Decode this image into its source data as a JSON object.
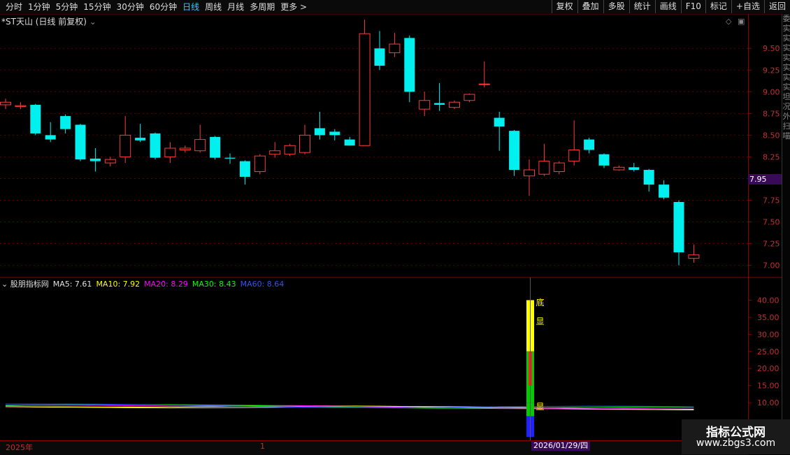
{
  "toolbar": {
    "periods": [
      "分时",
      "1分钟",
      "5分钟",
      "15分钟",
      "30分钟",
      "60分钟",
      "日线",
      "周线",
      "月线",
      "多周期",
      "更多 >"
    ],
    "active_period": "日线",
    "actions": [
      "复权",
      "叠加",
      "多股",
      "统计",
      "画线",
      "F10",
      "标记",
      "+自选",
      "返回"
    ]
  },
  "main_title": "*ST天山 (日线 前复权)",
  "price_axis_ticks": [
    "9.50",
    "9.25",
    "9.00",
    "8.75",
    "8.50",
    "8.25",
    "7.95",
    "7.75",
    "7.50",
    "7.25",
    "7.00"
  ],
  "current_price_label": "7.95",
  "indicator": {
    "name": "股朋指标网",
    "ma_labels": [
      {
        "text": "MA5: 7.61",
        "color": "#e0e0e0"
      },
      {
        "text": "MA10: 7.92",
        "color": "#ffff00"
      },
      {
        "text": "MA20: 8.29",
        "color": "#ff00ff"
      },
      {
        "text": "MA30: 8.43",
        "color": "#00ff00"
      },
      {
        "text": "MA60: 8.64",
        "color": "#3050ff"
      }
    ],
    "axis_ticks": [
      "40.00",
      "35.00",
      "30.00",
      "25.00",
      "20.00",
      "15.00",
      "10.00"
    ],
    "signal_texts": [
      "底",
      "显",
      "显"
    ]
  },
  "date_labels": {
    "left": "2025年",
    "mid": "1",
    "cursor": "2026/01/29/四"
  },
  "right_strip_chars": [
    "委",
    "实",
    "实",
    "实",
    "实",
    "实",
    "实",
    "实",
    "坦",
    "况",
    "外",
    "扫",
    "喵"
  ],
  "watermark": {
    "line1": "指标公式网",
    "line2": "www.zbgs3.com"
  },
  "chart_data": {
    "type": "candlestick",
    "y_axis": {
      "min": 6.9,
      "max": 9.8,
      "ticks": [
        7.0,
        7.25,
        7.5,
        7.75,
        8.0,
        8.25,
        8.5,
        8.75,
        9.0,
        9.25,
        9.5
      ]
    },
    "candles": [
      {
        "o": 8.85,
        "c": 8.88,
        "h": 8.92,
        "l": 8.8
      },
      {
        "o": 8.83,
        "c": 8.84,
        "h": 8.88,
        "l": 8.8
      },
      {
        "o": 8.85,
        "c": 8.52,
        "h": 8.86,
        "l": 8.5
      },
      {
        "o": 8.5,
        "c": 8.45,
        "h": 8.65,
        "l": 8.42
      },
      {
        "o": 8.72,
        "c": 8.57,
        "h": 8.74,
        "l": 8.52
      },
      {
        "o": 8.62,
        "c": 8.22,
        "h": 8.63,
        "l": 8.2
      },
      {
        "o": 8.23,
        "c": 8.2,
        "h": 8.35,
        "l": 8.08
      },
      {
        "o": 8.18,
        "c": 8.22,
        "h": 8.25,
        "l": 8.14
      },
      {
        "o": 8.25,
        "c": 8.5,
        "h": 8.72,
        "l": 8.18
      },
      {
        "o": 8.47,
        "c": 8.44,
        "h": 8.63,
        "l": 8.42
      },
      {
        "o": 8.52,
        "c": 8.24,
        "h": 8.53,
        "l": 8.22
      },
      {
        "o": 8.25,
        "c": 8.35,
        "h": 8.42,
        "l": 8.18
      },
      {
        "o": 8.33,
        "c": 8.35,
        "h": 8.38,
        "l": 8.3
      },
      {
        "o": 8.32,
        "c": 8.45,
        "h": 8.62,
        "l": 8.3
      },
      {
        "o": 8.48,
        "c": 8.24,
        "h": 8.49,
        "l": 8.22
      },
      {
        "o": 8.24,
        "c": 8.23,
        "h": 8.29,
        "l": 8.17
      },
      {
        "o": 8.2,
        "c": 8.02,
        "h": 8.21,
        "l": 7.93
      },
      {
        "o": 8.08,
        "c": 8.26,
        "h": 8.28,
        "l": 8.05
      },
      {
        "o": 8.28,
        "c": 8.32,
        "h": 8.42,
        "l": 8.24
      },
      {
        "o": 8.28,
        "c": 8.38,
        "h": 8.4,
        "l": 8.26
      },
      {
        "o": 8.3,
        "c": 8.5,
        "h": 8.62,
        "l": 8.28
      },
      {
        "o": 8.58,
        "c": 8.5,
        "h": 8.77,
        "l": 8.45
      },
      {
        "o": 8.54,
        "c": 8.5,
        "h": 8.57,
        "l": 8.44
      },
      {
        "o": 8.45,
        "c": 8.38,
        "h": 8.48,
        "l": 8.38
      },
      {
        "o": 8.38,
        "c": 9.67,
        "h": 9.83,
        "l": 8.38
      },
      {
        "o": 9.5,
        "c": 9.3,
        "h": 9.7,
        "l": 9.25
      },
      {
        "o": 9.45,
        "c": 9.55,
        "h": 9.68,
        "l": 9.4
      },
      {
        "o": 9.62,
        "c": 9.0,
        "h": 9.65,
        "l": 8.88
      },
      {
        "o": 8.8,
        "c": 8.9,
        "h": 9.0,
        "l": 8.72
      },
      {
        "o": 8.87,
        "c": 8.85,
        "h": 9.1,
        "l": 8.78
      },
      {
        "o": 8.82,
        "c": 8.88,
        "h": 8.9,
        "l": 8.8
      },
      {
        "o": 8.9,
        "c": 8.97,
        "h": 8.98,
        "l": 8.88
      },
      {
        "o": 9.09,
        "c": 9.09,
        "h": 9.35,
        "l": 9.05
      },
      {
        "o": 8.7,
        "c": 8.6,
        "h": 8.77,
        "l": 8.32
      },
      {
        "o": 8.55,
        "c": 8.1,
        "h": 8.56,
        "l": 8.03
      },
      {
        "o": 8.03,
        "c": 8.1,
        "h": 8.22,
        "l": 7.8
      },
      {
        "o": 8.05,
        "c": 8.2,
        "h": 8.4,
        "l": 8.03
      },
      {
        "o": 8.08,
        "c": 8.18,
        "h": 8.2,
        "l": 8.05
      },
      {
        "o": 8.2,
        "c": 8.33,
        "h": 8.67,
        "l": 8.15
      },
      {
        "o": 8.45,
        "c": 8.33,
        "h": 8.47,
        "l": 8.29
      },
      {
        "o": 8.28,
        "c": 8.15,
        "h": 8.29,
        "l": 8.12
      },
      {
        "o": 8.1,
        "c": 8.13,
        "h": 8.15,
        "l": 8.09
      },
      {
        "o": 8.13,
        "c": 8.1,
        "h": 8.18,
        "l": 8.08
      },
      {
        "o": 8.1,
        "c": 7.93,
        "h": 8.11,
        "l": 7.85
      },
      {
        "o": 7.93,
        "c": 7.78,
        "h": 7.98,
        "l": 7.76
      },
      {
        "o": 7.73,
        "c": 7.15,
        "h": 7.75,
        "l": 7.0
      },
      {
        "o": 7.08,
        "c": 7.12,
        "h": 7.24,
        "l": 7.03
      }
    ],
    "indicator_y_axis": {
      "min": 0,
      "max": 45,
      "ticks": [
        10,
        15,
        20,
        25,
        30,
        35,
        40
      ]
    },
    "signal_bar": {
      "index": 35,
      "segments": [
        {
          "from": 25,
          "to": 40,
          "color": "#ffff00"
        },
        {
          "from": 10,
          "to": 25,
          "color": "#00cc00"
        },
        {
          "from": 15,
          "to": 25,
          "color": "#ff2020"
        },
        {
          "from": 6,
          "to": 10,
          "color": "#00cc00"
        },
        {
          "from": 0,
          "to": 6,
          "color": "#2020ff"
        }
      ]
    }
  }
}
